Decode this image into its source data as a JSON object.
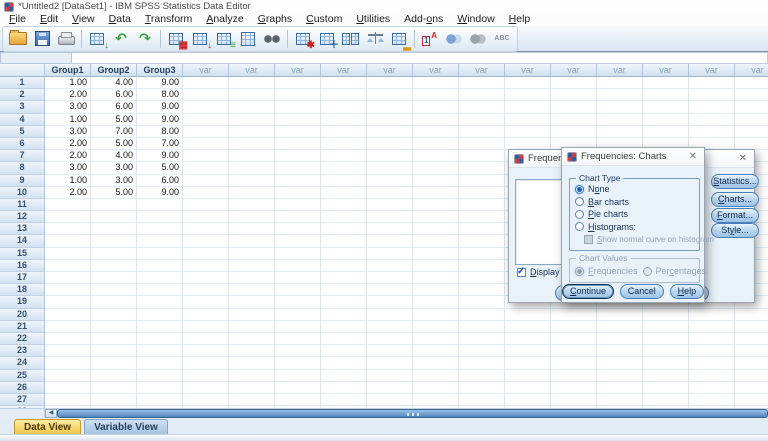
{
  "window": {
    "title": "*Untitled2 [DataSet1] - IBM SPSS Statistics Data Editor"
  },
  "menu": {
    "items": [
      {
        "label": "File",
        "u": 0
      },
      {
        "label": "Edit",
        "u": 0
      },
      {
        "label": "View",
        "u": 0
      },
      {
        "label": "Data",
        "u": 0
      },
      {
        "label": "Transform",
        "u": 0
      },
      {
        "label": "Analyze",
        "u": 0
      },
      {
        "label": "Graphs",
        "u": 0
      },
      {
        "label": "Custom",
        "u": 0
      },
      {
        "label": "Utilities",
        "u": 0
      },
      {
        "label": "Add-ons",
        "u": 4
      },
      {
        "label": "Window",
        "u": 0
      },
      {
        "label": "Help",
        "u": 0
      }
    ]
  },
  "toolbar": {
    "icons": [
      "open-file",
      "save",
      "print",
      "recall-dialogs",
      "undo",
      "redo",
      "go-to-chart",
      "go-to-case",
      "go-to-variable",
      "variables",
      "find",
      "insert-cases",
      "insert-variable",
      "split-file",
      "weight-cases",
      "select-cases",
      "value-labels",
      "use-variable-sets",
      "show-all-variables",
      "spell-check"
    ]
  },
  "cell_editor": {
    "reference": "",
    "value": ""
  },
  "grid": {
    "columns": [
      "Group1",
      "Group2",
      "Group3",
      "var",
      "var",
      "var",
      "var",
      "var",
      "var",
      "var",
      "var",
      "var",
      "var",
      "var",
      "var",
      "var",
      "var"
    ],
    "rows": [
      [
        "1.00",
        "4.00",
        "9.00"
      ],
      [
        "2.00",
        "6.00",
        "8.00"
      ],
      [
        "3.00",
        "6.00",
        "9.00"
      ],
      [
        "1.00",
        "5.00",
        "9.00"
      ],
      [
        "3.00",
        "7.00",
        "8.00"
      ],
      [
        "2.00",
        "5.00",
        "7.00"
      ],
      [
        "2.00",
        "4.00",
        "9.00"
      ],
      [
        "3.00",
        "3.00",
        "5.00"
      ],
      [
        "1.00",
        "3.00",
        "6.00"
      ],
      [
        "2.00",
        "5.00",
        "9.00"
      ],
      [],
      [],
      [],
      [],
      [],
      [],
      [],
      [],
      [],
      [],
      [],
      [],
      [],
      [],
      [],
      [],
      [],
      []
    ]
  },
  "tabs": {
    "data_view": "Data View",
    "variable_view": "Variable View",
    "active": "Data View"
  },
  "dialogs": {
    "frequencies": {
      "title": "Frequencies",
      "side_buttons": [
        {
          "label": "Statistics...",
          "u": 0
        },
        {
          "label": "Charts...",
          "u": 0
        },
        {
          "label": "Format...",
          "u": 0
        },
        {
          "label": "Style...",
          "u": 2
        }
      ],
      "display_checkbox": {
        "label": "Display freq",
        "u": 0,
        "checked": true
      }
    },
    "charts": {
      "title": "Frequencies: Charts",
      "chart_type": {
        "label": "Chart Type",
        "options": [
          {
            "label": "None",
            "u": 1,
            "selected": true
          },
          {
            "label": "Bar charts",
            "u": 0,
            "selected": false
          },
          {
            "label": "Pie charts",
            "u": 0,
            "selected": false
          },
          {
            "label": "Histograms:",
            "u": 0,
            "selected": false
          }
        ],
        "sub_checkbox": {
          "label": "Show normal curve on histogram",
          "u": 0,
          "checked": false,
          "disabled": true
        }
      },
      "chart_values": {
        "label": "Chart Values",
        "disabled": true,
        "options": [
          {
            "label": "Frequencies",
            "u": 0,
            "selected": true
          },
          {
            "label": "Percentages",
            "u": 3,
            "selected": false
          }
        ]
      },
      "buttons": [
        {
          "label": "Continue",
          "u": 0,
          "default": true
        },
        {
          "label": "Cancel",
          "u": -1,
          "default": false
        },
        {
          "label": "Help",
          "u": 0,
          "default": false
        }
      ]
    }
  },
  "colors": {
    "accent_blue": "#4a7fb8",
    "dialog_bg": "#e9f1f9",
    "tab_active": "#f2c64a",
    "header_blue": "#d0e0ef"
  }
}
